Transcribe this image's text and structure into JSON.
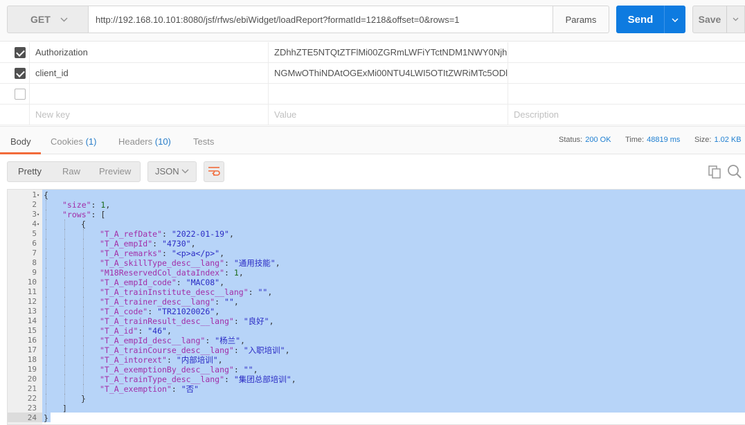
{
  "request": {
    "method": "GET",
    "url": "http://192.168.10.101:8080/jsf/rfws/ebiWidget/loadReport?formatId=1218&offset=0&rows=1",
    "params_label": "Params",
    "send_label": "Send",
    "save_label": "Save"
  },
  "headers": [
    {
      "key": "Authorization",
      "value": "ZDhhZTE5NTQtZTFlMi00ZGRmLWFiYTctNDM1NWY0Njh...",
      "checked": true
    },
    {
      "key": "client_id",
      "value": "NGMwOThiNDAtOGExMi00NTU4LWI5OTItZWRiMTc5ODl...",
      "checked": true
    },
    {
      "key": "",
      "value": "",
      "checked": false
    }
  ],
  "headers_placeholders": {
    "key": "New key",
    "value": "Value",
    "description": "Description"
  },
  "response_tabs": {
    "body": "Body",
    "cookies": "Cookies",
    "cookies_count": "(1)",
    "headers": "Headers",
    "headers_count": "(10)",
    "tests": "Tests"
  },
  "status": {
    "status_label": "Status:",
    "status_value": "200 OK",
    "time_label": "Time:",
    "time_value": "48819 ms",
    "size_label": "Size:",
    "size_value": "1.02 KB"
  },
  "view": {
    "pretty": "Pretty",
    "raw": "Raw",
    "preview": "Preview",
    "format": "JSON"
  },
  "code_lines": [
    {
      "n": "1",
      "fold": true,
      "indent": 0,
      "parts": [
        [
          "pun",
          "{"
        ]
      ]
    },
    {
      "n": "2",
      "fold": false,
      "indent": 1,
      "parts": [
        [
          "key",
          "\"size\""
        ],
        [
          "pun",
          ": "
        ],
        [
          "num",
          "1"
        ],
        [
          "pun",
          ","
        ]
      ]
    },
    {
      "n": "3",
      "fold": true,
      "indent": 1,
      "parts": [
        [
          "key",
          "\"rows\""
        ],
        [
          "pun",
          ": ["
        ]
      ]
    },
    {
      "n": "4",
      "fold": true,
      "indent": 2,
      "parts": [
        [
          "pun",
          "{"
        ]
      ]
    },
    {
      "n": "5",
      "fold": false,
      "indent": 3,
      "parts": [
        [
          "key",
          "\"T_A_refDate\""
        ],
        [
          "pun",
          ": "
        ],
        [
          "str",
          "\"2022-01-19\""
        ],
        [
          "pun",
          ","
        ]
      ]
    },
    {
      "n": "6",
      "fold": false,
      "indent": 3,
      "parts": [
        [
          "key",
          "\"T_A_empId\""
        ],
        [
          "pun",
          ": "
        ],
        [
          "str",
          "\"4730\""
        ],
        [
          "pun",
          ","
        ]
      ]
    },
    {
      "n": "7",
      "fold": false,
      "indent": 3,
      "parts": [
        [
          "key",
          "\"T_A_remarks\""
        ],
        [
          "pun",
          ": "
        ],
        [
          "str",
          "\"<p>a</p>\""
        ],
        [
          "pun",
          ","
        ]
      ]
    },
    {
      "n": "8",
      "fold": false,
      "indent": 3,
      "parts": [
        [
          "key",
          "\"T_A_skillType_desc__lang\""
        ],
        [
          "pun",
          ": "
        ],
        [
          "str",
          "\"通用技能\""
        ],
        [
          "pun",
          ","
        ]
      ]
    },
    {
      "n": "9",
      "fold": false,
      "indent": 3,
      "parts": [
        [
          "key",
          "\"M18ReservedCol_dataIndex\""
        ],
        [
          "pun",
          ": "
        ],
        [
          "num",
          "1"
        ],
        [
          "pun",
          ","
        ]
      ]
    },
    {
      "n": "10",
      "fold": false,
      "indent": 3,
      "parts": [
        [
          "key",
          "\"T_A_empId_code\""
        ],
        [
          "pun",
          ": "
        ],
        [
          "str",
          "\"MAC08\""
        ],
        [
          "pun",
          ","
        ]
      ]
    },
    {
      "n": "11",
      "fold": false,
      "indent": 3,
      "parts": [
        [
          "key",
          "\"T_A_trainInstitute_desc__lang\""
        ],
        [
          "pun",
          ": "
        ],
        [
          "str",
          "\"\""
        ],
        [
          "pun",
          ","
        ]
      ]
    },
    {
      "n": "12",
      "fold": false,
      "indent": 3,
      "parts": [
        [
          "key",
          "\"T_A_trainer_desc__lang\""
        ],
        [
          "pun",
          ": "
        ],
        [
          "str",
          "\"\""
        ],
        [
          "pun",
          ","
        ]
      ]
    },
    {
      "n": "13",
      "fold": false,
      "indent": 3,
      "parts": [
        [
          "key",
          "\"T_A_code\""
        ],
        [
          "pun",
          ": "
        ],
        [
          "str",
          "\"TR21020026\""
        ],
        [
          "pun",
          ","
        ]
      ]
    },
    {
      "n": "14",
      "fold": false,
      "indent": 3,
      "parts": [
        [
          "key",
          "\"T_A_trainResult_desc__lang\""
        ],
        [
          "pun",
          ": "
        ],
        [
          "str",
          "\"良好\""
        ],
        [
          "pun",
          ","
        ]
      ]
    },
    {
      "n": "15",
      "fold": false,
      "indent": 3,
      "parts": [
        [
          "key",
          "\"T_A_id\""
        ],
        [
          "pun",
          ": "
        ],
        [
          "str",
          "\"46\""
        ],
        [
          "pun",
          ","
        ]
      ]
    },
    {
      "n": "16",
      "fold": false,
      "indent": 3,
      "parts": [
        [
          "key",
          "\"T_A_empId_desc__lang\""
        ],
        [
          "pun",
          ": "
        ],
        [
          "str",
          "\"杨兰\""
        ],
        [
          "pun",
          ","
        ]
      ]
    },
    {
      "n": "17",
      "fold": false,
      "indent": 3,
      "parts": [
        [
          "key",
          "\"T_A_trainCourse_desc__lang\""
        ],
        [
          "pun",
          ": "
        ],
        [
          "str",
          "\"入职培训\""
        ],
        [
          "pun",
          ","
        ]
      ]
    },
    {
      "n": "18",
      "fold": false,
      "indent": 3,
      "parts": [
        [
          "key",
          "\"T_A_intorext\""
        ],
        [
          "pun",
          ": "
        ],
        [
          "str",
          "\"内部培训\""
        ],
        [
          "pun",
          ","
        ]
      ]
    },
    {
      "n": "19",
      "fold": false,
      "indent": 3,
      "parts": [
        [
          "key",
          "\"T_A_exemptionBy_desc__lang\""
        ],
        [
          "pun",
          ": "
        ],
        [
          "str",
          "\"\""
        ],
        [
          "pun",
          ","
        ]
      ]
    },
    {
      "n": "20",
      "fold": false,
      "indent": 3,
      "parts": [
        [
          "key",
          "\"T_A_trainType_desc__lang\""
        ],
        [
          "pun",
          ": "
        ],
        [
          "str",
          "\"集团总部培训\""
        ],
        [
          "pun",
          ","
        ]
      ]
    },
    {
      "n": "21",
      "fold": false,
      "indent": 3,
      "parts": [
        [
          "key",
          "\"T_A_exemption\""
        ],
        [
          "pun",
          ": "
        ],
        [
          "str",
          "\"否\""
        ]
      ]
    },
    {
      "n": "22",
      "fold": false,
      "indent": 2,
      "parts": [
        [
          "pun",
          "}"
        ]
      ]
    },
    {
      "n": "23",
      "fold": false,
      "indent": 1,
      "parts": [
        [
          "pun",
          "]"
        ]
      ]
    },
    {
      "n": "24",
      "fold": false,
      "indent": 0,
      "parts": [
        [
          "pun",
          "}"
        ]
      ]
    }
  ],
  "colors": {
    "send_blue": "#0e7be0",
    "active_tab_orange": "#f26b3a",
    "selection": "#b7d4f8",
    "json_key": "#a22ea8",
    "json_string": "#2a2ac4"
  },
  "icons": {
    "method_dropdown": "chevron-down-icon",
    "send_dropdown": "caret-down-icon",
    "save_dropdown": "caret-down-icon",
    "wrap": "wrap-lines-icon",
    "copy": "copy-icon",
    "search": "search-icon",
    "checkbox": "checkbox-icon",
    "fold": "fold-arrow-icon"
  }
}
